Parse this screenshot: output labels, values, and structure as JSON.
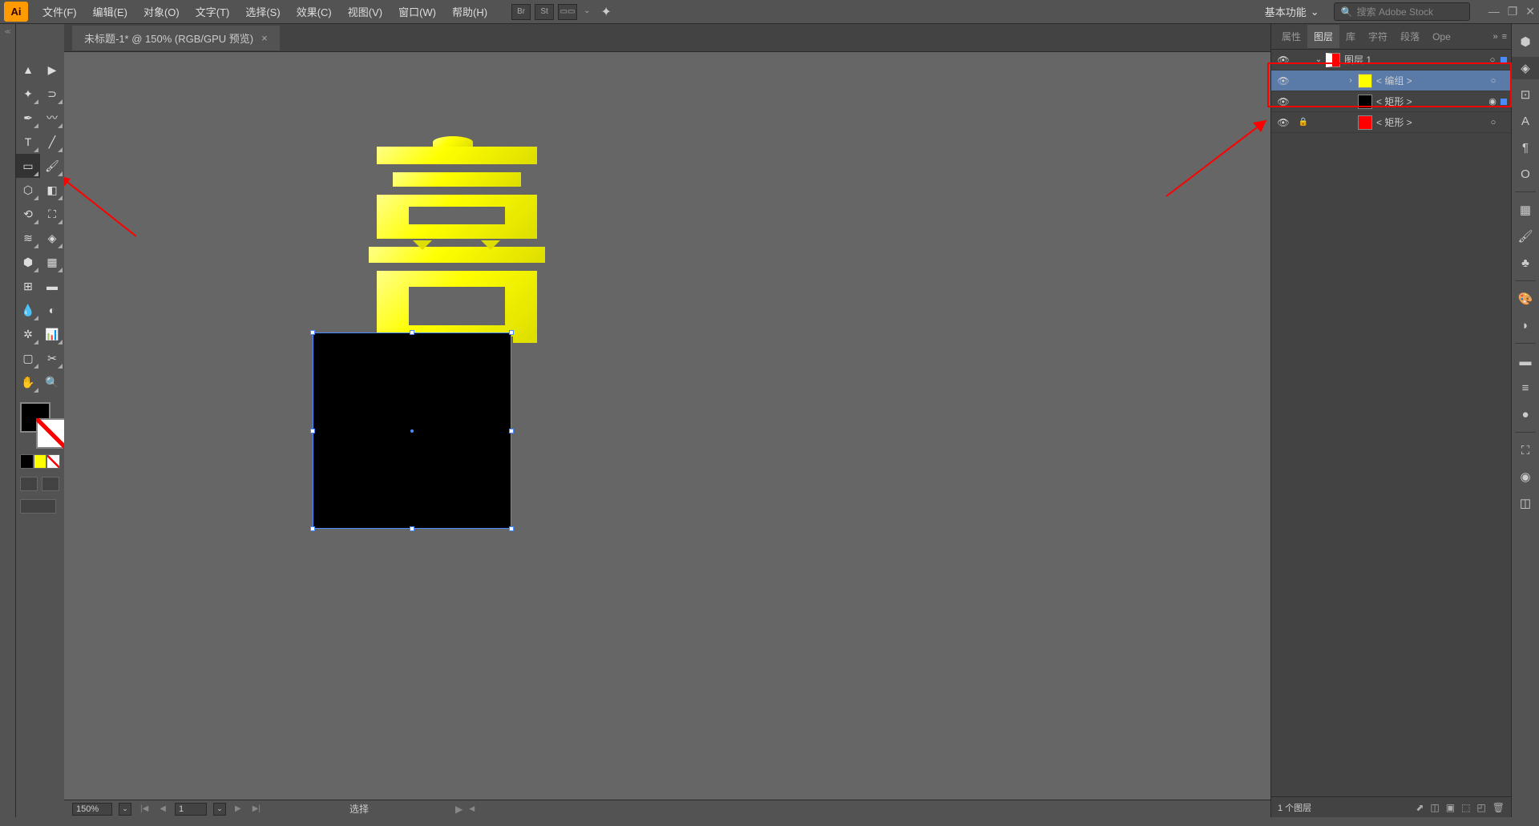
{
  "app": {
    "logo": "Ai"
  },
  "menu": {
    "file": "文件(F)",
    "edit": "编辑(E)",
    "object": "对象(O)",
    "text": "文字(T)",
    "select": "选择(S)",
    "effect": "效果(C)",
    "view": "视图(V)",
    "window": "窗口(W)",
    "help": "帮助(H)"
  },
  "menubar_icons": {
    "br": "Br",
    "st": "St"
  },
  "workspace": {
    "label": "基本功能",
    "chevron": "⌄"
  },
  "search": {
    "icon": "🔍",
    "placeholder": "搜索 Adobe Stock"
  },
  "window_controls": {
    "min": "—",
    "max": "❐",
    "close": "✕"
  },
  "tab": {
    "title": "未标题-1* @ 150% (RGB/GPU 预览)",
    "close": "×"
  },
  "panels": {
    "tabs": {
      "prop": "属性",
      "layers": "图层",
      "lib": "库",
      "chars": "字符",
      "para": "段落",
      "open": "Ope"
    },
    "more": "»",
    "menu": "≡"
  },
  "layers": {
    "l1": {
      "name": "图层 1",
      "eye": "👁"
    },
    "l2": {
      "name": "< 编组 >",
      "eye": "👁"
    },
    "l3": {
      "name": "< 矩形 >",
      "eye": "👁"
    },
    "l4": {
      "name": "< 矩形 >",
      "eye": "👁",
      "lock": "🔒"
    }
  },
  "layers_footer": {
    "count": "1 个图层"
  },
  "status": {
    "zoom": "150%",
    "artboard": "1",
    "mode": "选择"
  },
  "colors": {
    "fill": "#000000",
    "yellow": "#ffff00",
    "red": "#ff0000",
    "white": "#ffffff"
  },
  "chart_data": null
}
